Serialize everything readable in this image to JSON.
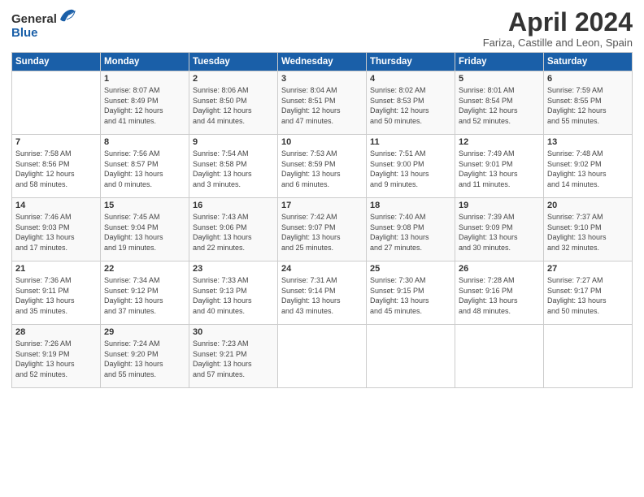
{
  "header": {
    "logo_general": "General",
    "logo_blue": "Blue",
    "month_title": "April 2024",
    "subtitle": "Fariza, Castille and Leon, Spain"
  },
  "days_of_week": [
    "Sunday",
    "Monday",
    "Tuesday",
    "Wednesday",
    "Thursday",
    "Friday",
    "Saturday"
  ],
  "weeks": [
    [
      {
        "day": "",
        "info": ""
      },
      {
        "day": "1",
        "info": "Sunrise: 8:07 AM\nSunset: 8:49 PM\nDaylight: 12 hours\nand 41 minutes."
      },
      {
        "day": "2",
        "info": "Sunrise: 8:06 AM\nSunset: 8:50 PM\nDaylight: 12 hours\nand 44 minutes."
      },
      {
        "day": "3",
        "info": "Sunrise: 8:04 AM\nSunset: 8:51 PM\nDaylight: 12 hours\nand 47 minutes."
      },
      {
        "day": "4",
        "info": "Sunrise: 8:02 AM\nSunset: 8:53 PM\nDaylight: 12 hours\nand 50 minutes."
      },
      {
        "day": "5",
        "info": "Sunrise: 8:01 AM\nSunset: 8:54 PM\nDaylight: 12 hours\nand 52 minutes."
      },
      {
        "day": "6",
        "info": "Sunrise: 7:59 AM\nSunset: 8:55 PM\nDaylight: 12 hours\nand 55 minutes."
      }
    ],
    [
      {
        "day": "7",
        "info": "Sunrise: 7:58 AM\nSunset: 8:56 PM\nDaylight: 12 hours\nand 58 minutes."
      },
      {
        "day": "8",
        "info": "Sunrise: 7:56 AM\nSunset: 8:57 PM\nDaylight: 13 hours\nand 0 minutes."
      },
      {
        "day": "9",
        "info": "Sunrise: 7:54 AM\nSunset: 8:58 PM\nDaylight: 13 hours\nand 3 minutes."
      },
      {
        "day": "10",
        "info": "Sunrise: 7:53 AM\nSunset: 8:59 PM\nDaylight: 13 hours\nand 6 minutes."
      },
      {
        "day": "11",
        "info": "Sunrise: 7:51 AM\nSunset: 9:00 PM\nDaylight: 13 hours\nand 9 minutes."
      },
      {
        "day": "12",
        "info": "Sunrise: 7:49 AM\nSunset: 9:01 PM\nDaylight: 13 hours\nand 11 minutes."
      },
      {
        "day": "13",
        "info": "Sunrise: 7:48 AM\nSunset: 9:02 PM\nDaylight: 13 hours\nand 14 minutes."
      }
    ],
    [
      {
        "day": "14",
        "info": "Sunrise: 7:46 AM\nSunset: 9:03 PM\nDaylight: 13 hours\nand 17 minutes."
      },
      {
        "day": "15",
        "info": "Sunrise: 7:45 AM\nSunset: 9:04 PM\nDaylight: 13 hours\nand 19 minutes."
      },
      {
        "day": "16",
        "info": "Sunrise: 7:43 AM\nSunset: 9:06 PM\nDaylight: 13 hours\nand 22 minutes."
      },
      {
        "day": "17",
        "info": "Sunrise: 7:42 AM\nSunset: 9:07 PM\nDaylight: 13 hours\nand 25 minutes."
      },
      {
        "day": "18",
        "info": "Sunrise: 7:40 AM\nSunset: 9:08 PM\nDaylight: 13 hours\nand 27 minutes."
      },
      {
        "day": "19",
        "info": "Sunrise: 7:39 AM\nSunset: 9:09 PM\nDaylight: 13 hours\nand 30 minutes."
      },
      {
        "day": "20",
        "info": "Sunrise: 7:37 AM\nSunset: 9:10 PM\nDaylight: 13 hours\nand 32 minutes."
      }
    ],
    [
      {
        "day": "21",
        "info": "Sunrise: 7:36 AM\nSunset: 9:11 PM\nDaylight: 13 hours\nand 35 minutes."
      },
      {
        "day": "22",
        "info": "Sunrise: 7:34 AM\nSunset: 9:12 PM\nDaylight: 13 hours\nand 37 minutes."
      },
      {
        "day": "23",
        "info": "Sunrise: 7:33 AM\nSunset: 9:13 PM\nDaylight: 13 hours\nand 40 minutes."
      },
      {
        "day": "24",
        "info": "Sunrise: 7:31 AM\nSunset: 9:14 PM\nDaylight: 13 hours\nand 43 minutes."
      },
      {
        "day": "25",
        "info": "Sunrise: 7:30 AM\nSunset: 9:15 PM\nDaylight: 13 hours\nand 45 minutes."
      },
      {
        "day": "26",
        "info": "Sunrise: 7:28 AM\nSunset: 9:16 PM\nDaylight: 13 hours\nand 48 minutes."
      },
      {
        "day": "27",
        "info": "Sunrise: 7:27 AM\nSunset: 9:17 PM\nDaylight: 13 hours\nand 50 minutes."
      }
    ],
    [
      {
        "day": "28",
        "info": "Sunrise: 7:26 AM\nSunset: 9:19 PM\nDaylight: 13 hours\nand 52 minutes."
      },
      {
        "day": "29",
        "info": "Sunrise: 7:24 AM\nSunset: 9:20 PM\nDaylight: 13 hours\nand 55 minutes."
      },
      {
        "day": "30",
        "info": "Sunrise: 7:23 AM\nSunset: 9:21 PM\nDaylight: 13 hours\nand 57 minutes."
      },
      {
        "day": "",
        "info": ""
      },
      {
        "day": "",
        "info": ""
      },
      {
        "day": "",
        "info": ""
      },
      {
        "day": "",
        "info": ""
      }
    ]
  ]
}
